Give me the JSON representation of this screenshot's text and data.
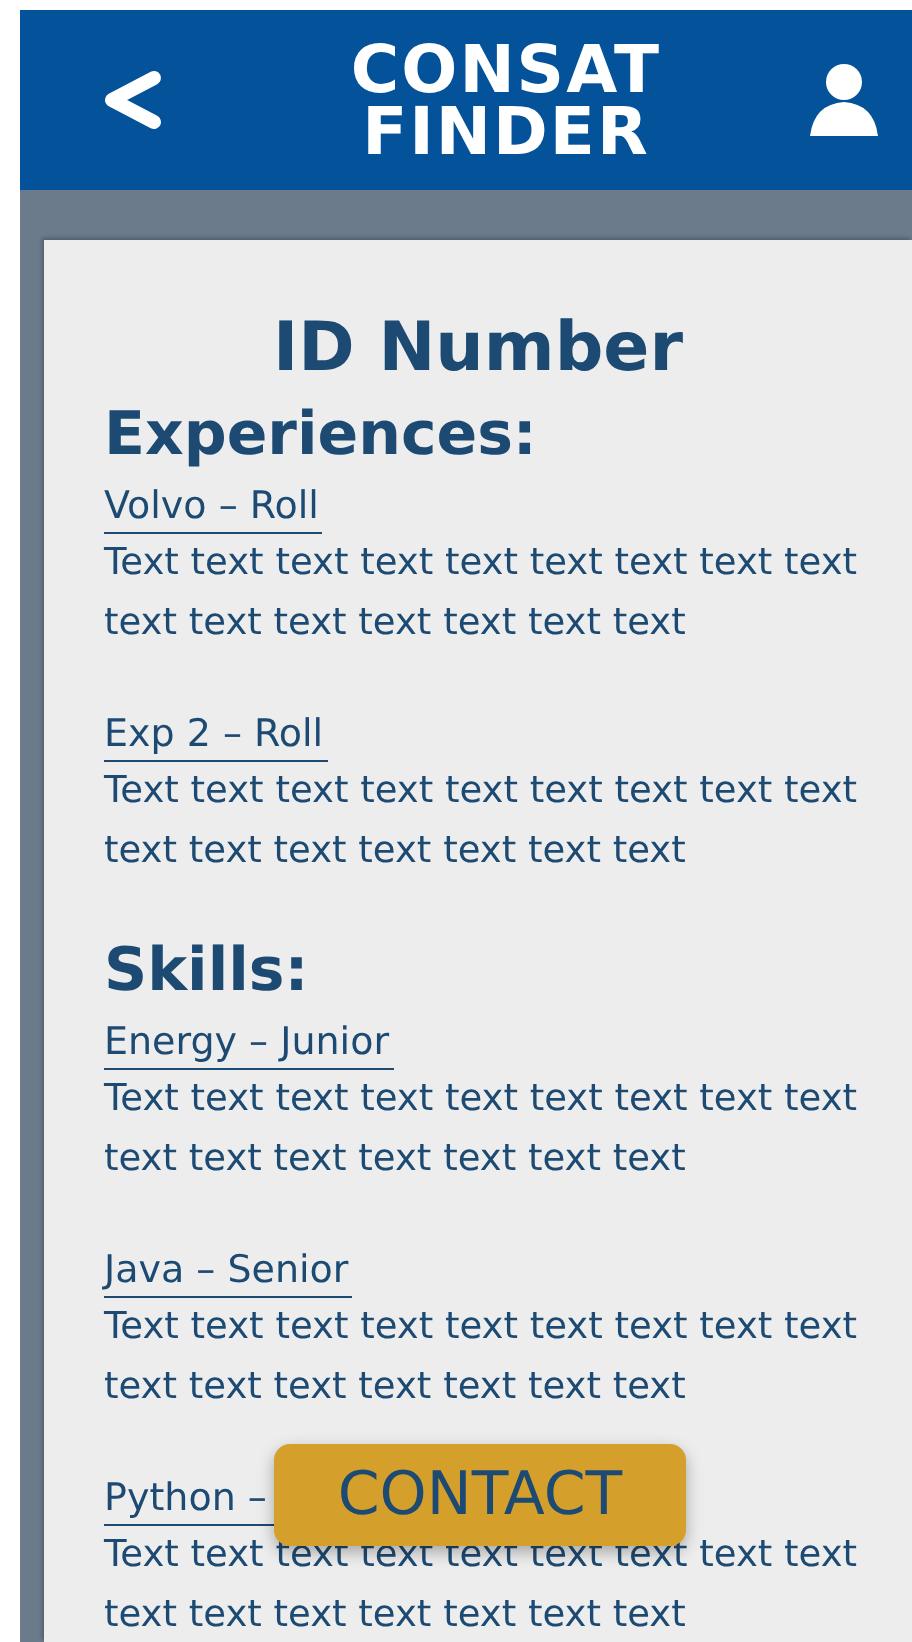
{
  "header": {
    "logo_lines": [
      "CONSAT",
      "FINDER"
    ]
  },
  "profile": {
    "title": "ID Number"
  },
  "sections": [
    {
      "heading": "Experiences:",
      "items": [
        {
          "title": "Volvo – Roll",
          "text": "Text text text text text text text text text text text text text text text text"
        },
        {
          "title": "Exp 2 – Roll",
          "text": "Text text text text text text text text text text text text text text text text"
        }
      ]
    },
    {
      "heading": "Skills:",
      "items": [
        {
          "title": "Energy – Junior",
          "text": "Text text text text text text text text text text text text text text text text"
        },
        {
          "title": "Java – Senior",
          "text": "Text text text text text text text text text text text text text text text text"
        },
        {
          "title": "Python –",
          "text": "Text text text text text text text text text text text text text text text text"
        }
      ]
    }
  ],
  "contact_button": {
    "label": "CONTACT"
  }
}
